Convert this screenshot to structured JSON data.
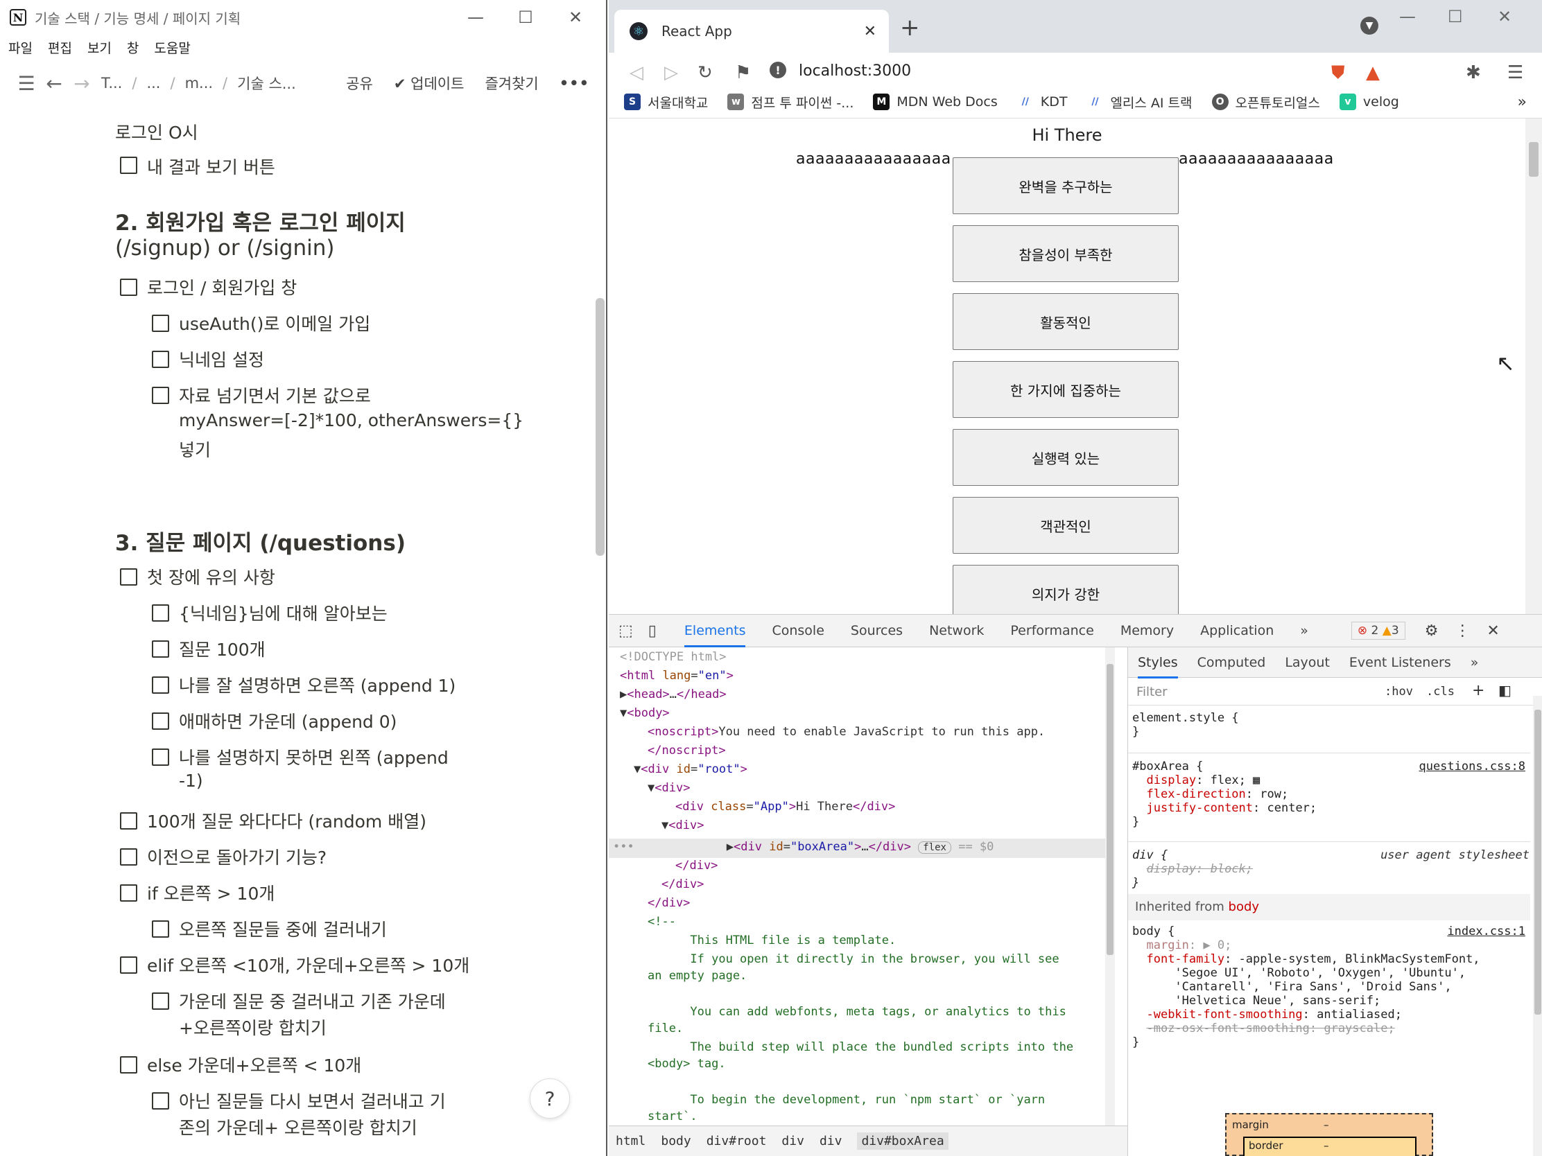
{
  "notion": {
    "window_title": "기술 스택 / 기능 명세 / 페이지 기획",
    "menu": [
      "파일",
      "편집",
      "보기",
      "창",
      "도움말"
    ],
    "breadcrumbs": [
      "T...",
      "...",
      "m...",
      "기술 스..."
    ],
    "share": "공유",
    "update": "업데이트",
    "favorite": "즐겨찾기",
    "more": "•••",
    "lines": [
      {
        "text": "로그인 O시",
        "check": false
      },
      {
        "text": "내 결과 보기 버튼",
        "check": true
      },
      {
        "text": "2. 회원가입 혹은 로그인 페이지",
        "heading": true
      },
      {
        "text": "(/signup) or (/signin)",
        "heading": true
      },
      {
        "text": "로그인 / 회원가입 창",
        "check": true
      },
      {
        "text": "useAuth()로 이메일 가입",
        "check": true
      },
      {
        "text": "닉네임 설정",
        "check": true
      },
      {
        "text": "자료 넘기면서 기본 값으로",
        "check": true
      },
      {
        "text": "myAnswer=[-2]*100, otherAnswers={}",
        "check": false
      },
      {
        "text": "넣기",
        "check": false
      },
      {
        "text": "3. 질문 페이지 (/questions)",
        "heading": true
      },
      {
        "text": "첫 장에 유의 사항",
        "check": true
      },
      {
        "text": "{닉네임}님에 대해 알아보는",
        "check": true
      },
      {
        "text": "질문 100개",
        "check": true
      },
      {
        "text": "나를 잘 설명하면 오른쪽 (append 1)",
        "check": true
      },
      {
        "text": "애매하면 가운데 (append 0)",
        "check": true
      },
      {
        "text": "나를 설명하지 못하면 왼쪽 (append",
        "check": true
      },
      {
        "text": "-1)",
        "check": false
      },
      {
        "text": "100개 질문 와다다다 (random 배열)",
        "check": true
      },
      {
        "text": "이전으로 돌아가기 기능?",
        "check": true
      },
      {
        "text": "if 오른쪽 > 10개",
        "check": true
      },
      {
        "text": "오른쪽 질문들 중에 걸러내기",
        "check": true
      },
      {
        "text": "elif 오른쪽 <10개, 가운데+오른쪽 > 10개",
        "check": true
      },
      {
        "text": "가운데 질문 중 걸러내고 기존 가운데",
        "check": true
      },
      {
        "text": "+오른쪽이랑 합치기",
        "check": false
      },
      {
        "text": "else 가운데+오른쪽 < 10개",
        "check": true
      },
      {
        "text": "아닌 질문들 다시 보면서 걸러내고 기",
        "check": true
      },
      {
        "text": "존의 가운데+ 오른쪽이랑 합치기",
        "check": false
      }
    ],
    "help": "?"
  },
  "browser": {
    "tab_title": "React App",
    "url": "localhost:3000",
    "bookmarks": [
      {
        "label": "서울대학교",
        "color": "#1d3f8a",
        "glyph": "S"
      },
      {
        "label": "점프 투 파이썬 -...",
        "color": "#777",
        "glyph": "w"
      },
      {
        "label": "MDN Web Docs",
        "color": "#111",
        "glyph": "M"
      },
      {
        "label": "KDT",
        "color": "#3a6bd6",
        "glyph": "//"
      },
      {
        "label": "엘리스 AI 트랙",
        "color": "#3a6bd6",
        "glyph": "//"
      },
      {
        "label": "오픈튜토리얼스",
        "color": "#555",
        "glyph": "O"
      },
      {
        "label": "velog",
        "color": "#20c997",
        "glyph": "v"
      }
    ],
    "page": {
      "heading": "Hi There",
      "side_text": "aaaaaaaaaaaaaaaa",
      "buttons": [
        "완벽을 추구하는",
        "참을성이 부족한",
        "활동적인",
        "한 가지에 집중하는",
        "실행력 있는",
        "객관적인",
        "의지가 강한"
      ]
    }
  },
  "devtools": {
    "tabs": [
      "Elements",
      "Console",
      "Sources",
      "Network",
      "Performance",
      "Memory",
      "Application"
    ],
    "errors": "2",
    "warnings": "3",
    "style_tabs": [
      "Styles",
      "Computed",
      "Layout",
      "Event Listeners"
    ],
    "filter_placeholder": "Filter",
    "hov": ":hov",
    "cls": ".cls",
    "breadcrumbs": [
      "html",
      "body",
      "div#root",
      "div",
      "div",
      "div#boxArea"
    ],
    "inherited_label": "Inherited from",
    "inherited_from": "body",
    "boxmodel": {
      "margin": "margin",
      "border": "border",
      "dash": "–"
    }
  }
}
